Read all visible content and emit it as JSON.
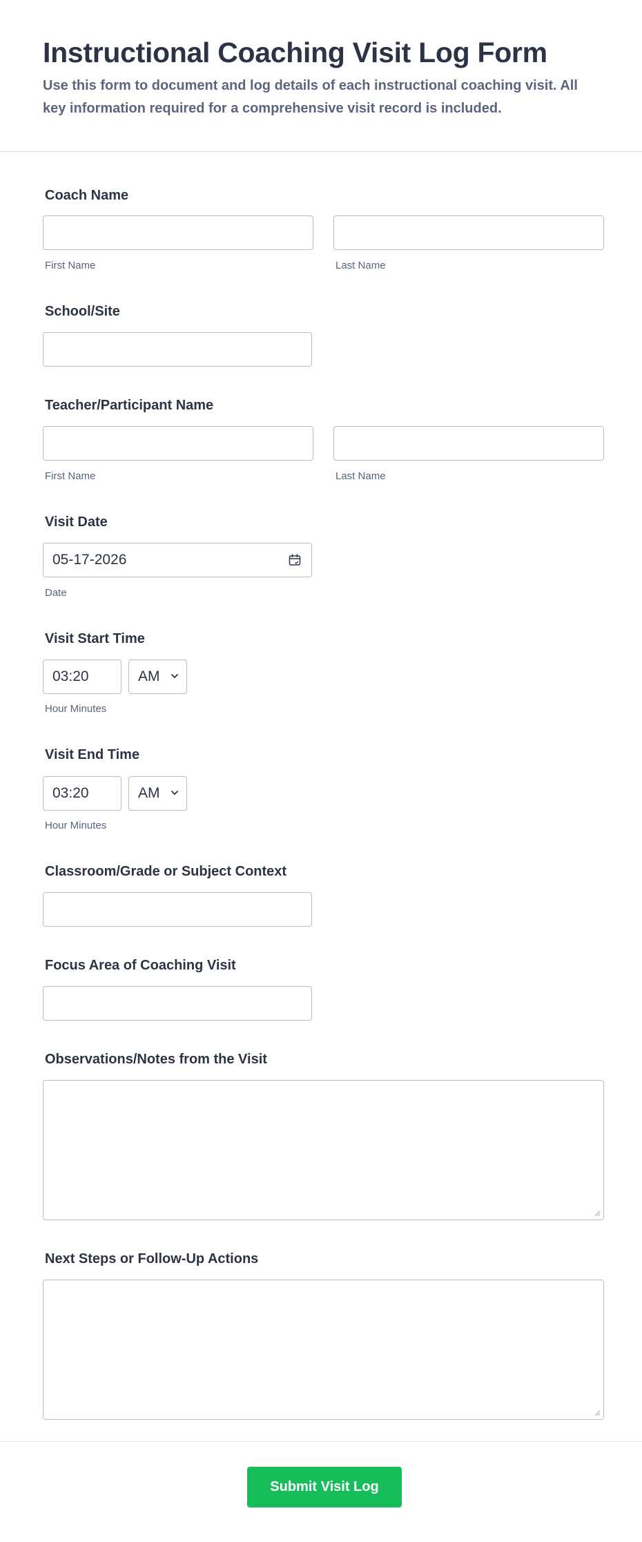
{
  "form": {
    "title": "Instructional Coaching Visit Log Form",
    "description": "Use this form to document and log details of each instructional coaching visit. All key information required for a comprehensive visit record is included."
  },
  "fields": {
    "coach_name": {
      "label": "Coach Name",
      "first_sublabel": "First Name",
      "last_sublabel": "Last Name",
      "first_value": "",
      "last_value": ""
    },
    "school_site": {
      "label": "School/Site",
      "value": ""
    },
    "teacher_name": {
      "label": "Teacher/Participant Name",
      "first_sublabel": "First Name",
      "last_sublabel": "Last Name",
      "first_value": "",
      "last_value": ""
    },
    "visit_date": {
      "label": "Visit Date",
      "value": "05-17-2026",
      "sublabel": "Date",
      "icon": "calendar-icon"
    },
    "start_time": {
      "label": "Visit Start Time",
      "time_value": "03:20",
      "ampm_value": "AM",
      "sublabel": "Hour Minutes"
    },
    "end_time": {
      "label": "Visit End Time",
      "time_value": "03:20",
      "ampm_value": "AM",
      "sublabel": "Hour Minutes"
    },
    "classroom_context": {
      "label": "Classroom/Grade or Subject Context",
      "value": ""
    },
    "focus_area": {
      "label": "Focus Area of Coaching Visit",
      "value": ""
    },
    "observations": {
      "label": "Observations/Notes from the Visit",
      "value": ""
    },
    "next_steps": {
      "label": "Next Steps or Follow-Up Actions",
      "value": ""
    }
  },
  "submit": {
    "label": "Submit Visit Log",
    "color": "#18bd5b"
  }
}
